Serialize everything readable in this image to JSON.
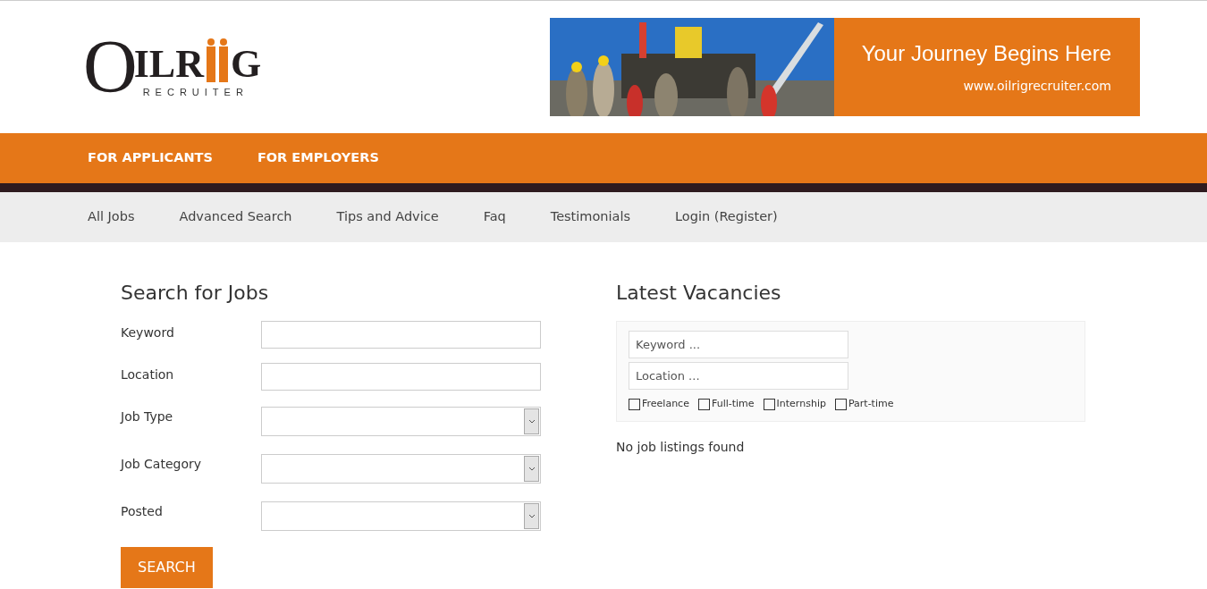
{
  "logo": {
    "wordmark_left": "OILR",
    "wordmark_right": "G",
    "tagline": "RECRUITER"
  },
  "banner": {
    "kind": "picture",
    "headline": "Your Journey Begins Here",
    "url": "www.oilrigrecruiter.com"
  },
  "main_nav": [
    {
      "label": "FOR APPLICANTS"
    },
    {
      "label": "FOR EMPLOYERS"
    }
  ],
  "sub_nav": [
    {
      "label": "All Jobs"
    },
    {
      "label": "Advanced Search"
    },
    {
      "label": "Tips and Advice"
    },
    {
      "label": "Faq"
    },
    {
      "label": "Testimonials"
    },
    {
      "label": "Login (Register)"
    }
  ],
  "search_form": {
    "title": "Search for Jobs",
    "fields": [
      {
        "label": "Keyword",
        "kind": "text"
      },
      {
        "label": "Location",
        "kind": "text"
      },
      {
        "label": "Job Type",
        "kind": "select"
      },
      {
        "label": "Job Category",
        "kind": "select"
      },
      {
        "label": "Posted",
        "kind": "select"
      }
    ],
    "button": "SEARCH"
  },
  "vacancies": {
    "title": "Latest Vacancies",
    "fields": [
      {
        "placeholder": "Keyword ..."
      },
      {
        "placeholder": "Location ..."
      }
    ],
    "job_types": [
      {
        "label": "Freelance",
        "checked": false
      },
      {
        "label": "Full-time",
        "checked": false
      },
      {
        "label": "Internship",
        "checked": false
      },
      {
        "label": "Part-time",
        "checked": false
      }
    ],
    "empty_message": "No job listings found"
  }
}
